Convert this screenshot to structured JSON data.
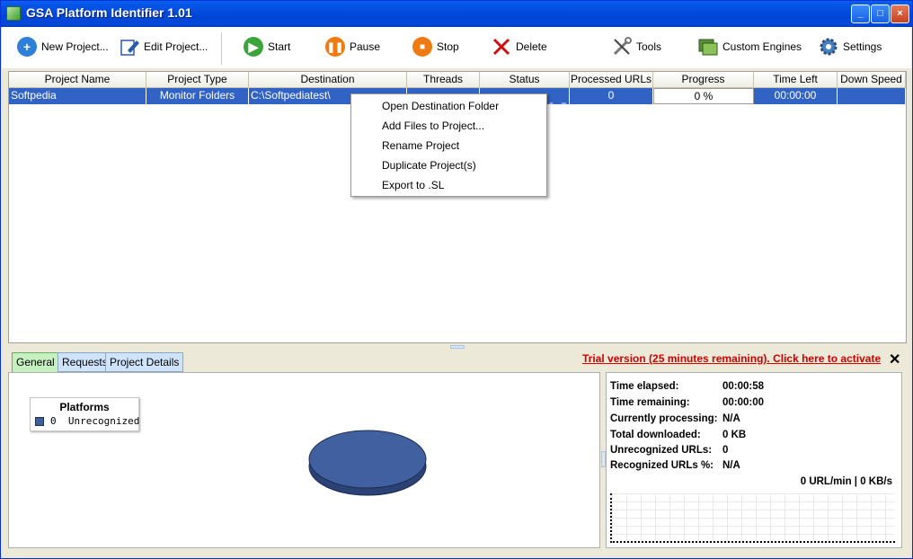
{
  "window": {
    "title": "GSA Platform Identifier 1.01"
  },
  "titlebar_buttons": {
    "minimize": "_",
    "maximize": "□",
    "close": "×"
  },
  "toolbar": {
    "new_project": "New Project...",
    "edit_project": "Edit Project...",
    "start": "Start",
    "pause": "Pause",
    "stop": "Stop",
    "delete": "Delete",
    "tools": "Tools",
    "custom_engines": "Custom Engines",
    "settings": "Settings"
  },
  "table": {
    "columns": [
      "Project Name",
      "Project Type",
      "Destination",
      "Threads",
      "Status",
      "Processed URLs",
      "Progress",
      "Time Left",
      "Down Speed"
    ],
    "rows": [
      {
        "project_name": "Softpedia",
        "project_type": "Monitor Folders",
        "destination": "C:\\Softpediatest\\",
        "threads": "",
        "status": "",
        "processed_urls": "0",
        "progress": "0 %",
        "time_left": "00:00:00",
        "down_speed": ""
      }
    ],
    "watermark": "SOFTPEDIA"
  },
  "context_menu": {
    "items": [
      "Open Destination Folder",
      "Add Files to Project...",
      "Rename Project",
      "Duplicate Project(s)",
      "Export to .SL"
    ]
  },
  "bottom_tabs": [
    "General",
    "Requests",
    "Project Details"
  ],
  "trial_link": "Trial version (25 minutes remaining). Click here to activate",
  "close_symbol": "✕",
  "legend": {
    "title": "Platforms",
    "count": "0",
    "label": "Unrecognized",
    "color": "#3f5e9a"
  },
  "stats": {
    "time_elapsed_label": "Time elapsed:",
    "time_elapsed": "00:00:58",
    "time_remaining_label": "Time remaining:",
    "time_remaining": "00:00:00",
    "currently_processing_label": "Currently processing:",
    "currently_processing": "N/A",
    "total_downloaded_label": "Total downloaded:",
    "total_downloaded": "0 KB",
    "unrecognized_label": "Unrecognized URLs:",
    "unrecognized": "0",
    "recognized_label": "Recognized URLs %:",
    "recognized": "N/A",
    "rate": "0 URL/min | 0 KB/s"
  },
  "colors": {
    "selection": "#3163c5",
    "trial": "#d00000",
    "titlebar": "#0046d5",
    "pie": "#3f5e9a"
  }
}
